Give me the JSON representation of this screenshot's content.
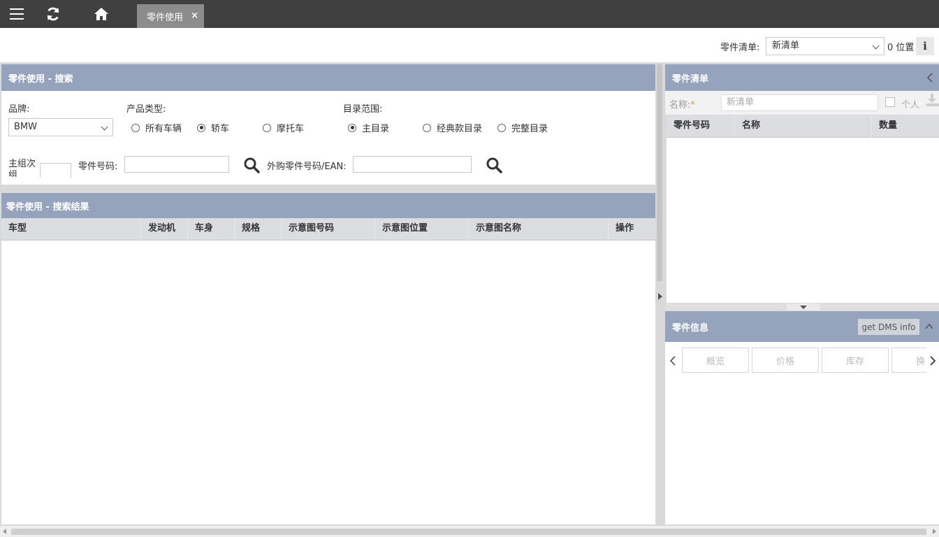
{
  "topbar": {
    "tab_label": "零件使用",
    "tab_close": "×"
  },
  "subheader": {
    "list_label": "零件清单:",
    "list_value": "新清单",
    "position_text": "0 位置",
    "info": "i"
  },
  "search": {
    "title": "零件使用 - 搜索",
    "brand_label": "品牌:",
    "brand_value": "BMW",
    "product_type_label": "产品类型:",
    "product_types": [
      "所有车辆",
      "轿车",
      "摩托车"
    ],
    "product_type_selected": "轿车",
    "catalog_label": "目录范围:",
    "catalogs": [
      "主目录",
      "经典款目录",
      "完整目录"
    ],
    "catalog_selected": "主目录",
    "main_group_label": "主组次\n组",
    "part_number_label": "零件号码:",
    "external_label": "外购零件号码/EAN:"
  },
  "results": {
    "title": "零件使用 - 搜索结果",
    "columns": [
      "车型",
      "发动机",
      "车身",
      "规格",
      "示意图号码",
      "示意图位置",
      "示意图名称",
      "操作"
    ]
  },
  "parts_list": {
    "title": "零件清单",
    "name_label": "名称:",
    "name_required_mark": "*",
    "name_value": "新清单",
    "personal_label": "个人",
    "columns": [
      "零件号码",
      "名称",
      "数量"
    ]
  },
  "part_info": {
    "title": "零件信息",
    "dms_button": "get DMS info",
    "tabs": [
      "概览",
      "价格",
      "库存",
      "换"
    ]
  },
  "icons": [
    "menu-icon",
    "refresh-icon",
    "home-icon",
    "search-icon",
    "download-icon",
    "chevron-left-icon",
    "chevron-right-icon",
    "chevron-up-icon"
  ]
}
